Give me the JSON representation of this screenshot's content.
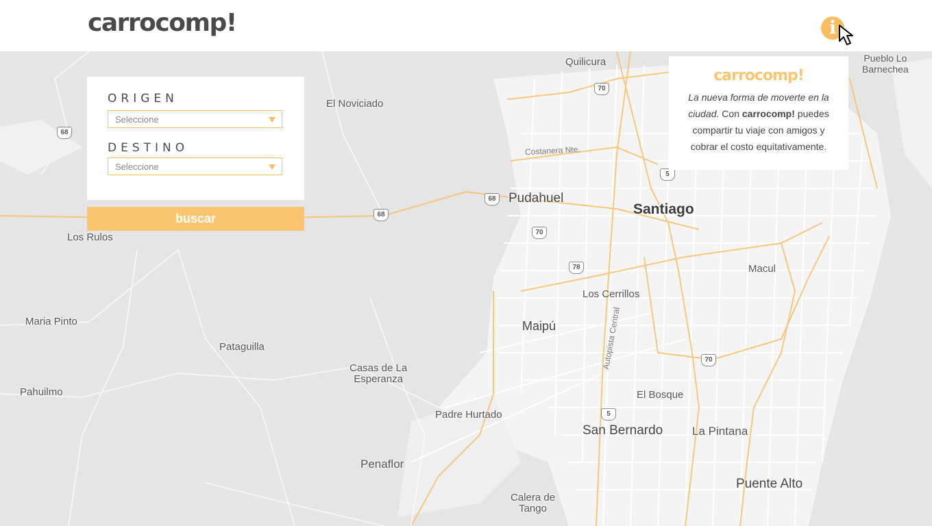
{
  "header": {
    "logo": "carrocomp!",
    "info_icon": "i"
  },
  "search": {
    "origin_label": "ORIGEN",
    "origin_value": "Seleccione",
    "destination_label": "DESTINO",
    "destination_value": "Seleccione",
    "search_button": "buscar"
  },
  "info": {
    "title": "carrocomp!",
    "text_italic": "La nueva forma de moverte en la ciudad.",
    "text_con": " Con ",
    "text_brand": "carrocomp!",
    "text_rest": " puedes compartir tu viaje con amigos y cobrar el costo equitativamente."
  },
  "map": {
    "places": {
      "quilicura": "Quilicura",
      "pueblo": "Pueblo Lo\nBarnechea",
      "noviciado": "El Noviciado",
      "pudahuel": "Pudahuel",
      "santiago": "Santiago",
      "losrulos": "Los Rulos",
      "macul": "Macul",
      "loscerrillos": "Los Cerrillos",
      "mariapinto": "Maria Pinto",
      "maipu": "Maipú",
      "pataguilla": "Pataguilla",
      "casas": "Casas de La\nEsperanza",
      "pahuilmo": "Pahuilmo",
      "elbosque": "El Bosque",
      "padrehurtado": "Padre Hurtado",
      "sanbernardo": "San Bernardo",
      "lapintana": "La Pintana",
      "penaflor": "Penaflor",
      "puentealto": "Puente Alto",
      "calera": "Calera de\nTango"
    },
    "roads": {
      "costanera": "Costanera Nte.",
      "autopista": "Autopista Central"
    },
    "shields": {
      "s70a": "70",
      "s68a": "68",
      "s5a": "5",
      "s68b": "68",
      "s68c": "68",
      "s70b": "70",
      "s78": "78",
      "s70c": "70",
      "s5b": "5"
    }
  },
  "colors": {
    "accent": "#fcc570",
    "logo": "#4a4a4a",
    "map_bg": "#e5e5e5"
  }
}
